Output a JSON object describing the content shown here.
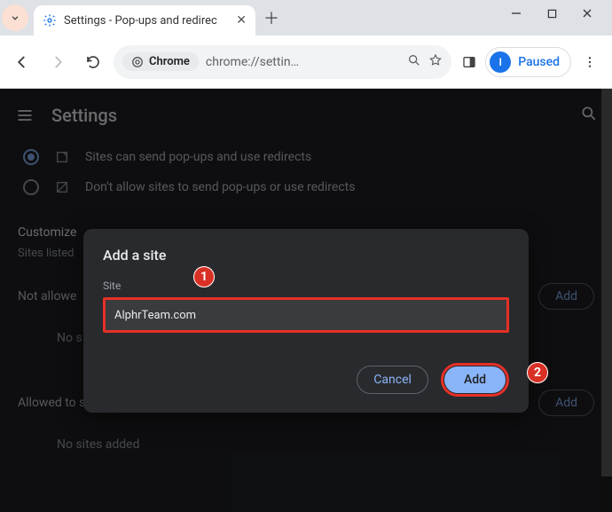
{
  "tab": {
    "title": "Settings - Pop-ups and redirec"
  },
  "toolbar": {
    "chrome_chip": "Chrome",
    "url": "chrome://settin…",
    "paused_label": "Paused",
    "avatar_initial": "I"
  },
  "page": {
    "title": "Settings",
    "option_allow": "Sites can send pop-ups and use redirects",
    "option_block": "Don't allow sites to send pop-ups or use redirects",
    "customize_h": "Customize",
    "customize_sub": "Sites listed",
    "not_allowed_h": "Not allowe",
    "not_allowed_empty": "No s",
    "allowed_h": "Allowed to send pop-ups and use redirects",
    "no_sites": "No sites added",
    "add_label": "Add"
  },
  "dialog": {
    "title": "Add a site",
    "field_label": "Site",
    "value": "AlphrTeam.com",
    "cancel": "Cancel",
    "add": "Add"
  },
  "annotations": {
    "one": "1",
    "two": "2"
  }
}
